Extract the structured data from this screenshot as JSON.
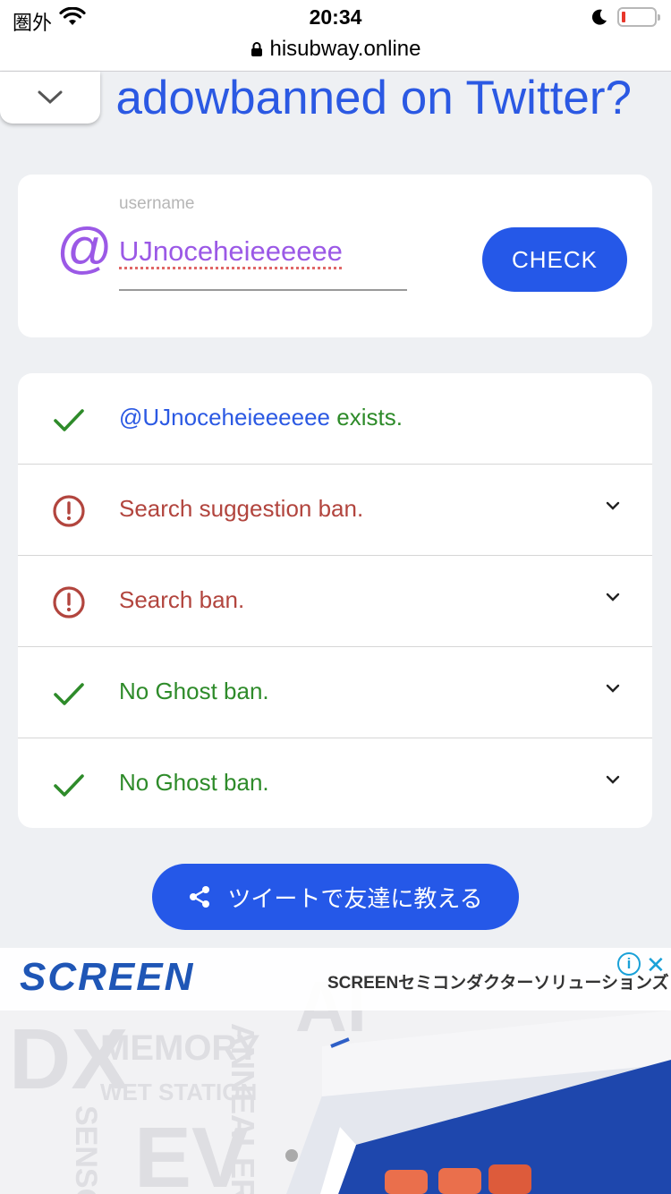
{
  "status": {
    "carrier": "圏外",
    "time": "20:34"
  },
  "browser": {
    "url": "hisubway.online"
  },
  "header": {
    "title": "adowbanned on Twitter?"
  },
  "form": {
    "label": "username",
    "value": "UJnoceheieeeeee",
    "check_label": "CHECK"
  },
  "results": [
    {
      "handle": "@UJnoceheieeeeee",
      "text": " exists.",
      "status": "ok"
    },
    {
      "text": "Search suggestion ban.",
      "status": "banned"
    },
    {
      "text": "Search ban.",
      "status": "banned"
    },
    {
      "text": "No Ghost ban.",
      "status": "ok"
    },
    {
      "text": "No Ghost ban.",
      "status": "ok"
    }
  ],
  "share": {
    "label": "ツイートで友達に教える"
  },
  "ad": {
    "brand": "SCREEN",
    "tagline": "SCREENセミコンダクターソリューションズ",
    "info_label": "i",
    "close_label": "✕",
    "bg_words": [
      "DX",
      "MEMORY",
      "WET STATION",
      "ANNEALER",
      "EV",
      "SENSOR",
      "AI"
    ]
  },
  "colors": {
    "accent": "#2558e8",
    "ok": "#2e8b2a",
    "banned": "#b2453e",
    "at": "#9b59e6"
  }
}
